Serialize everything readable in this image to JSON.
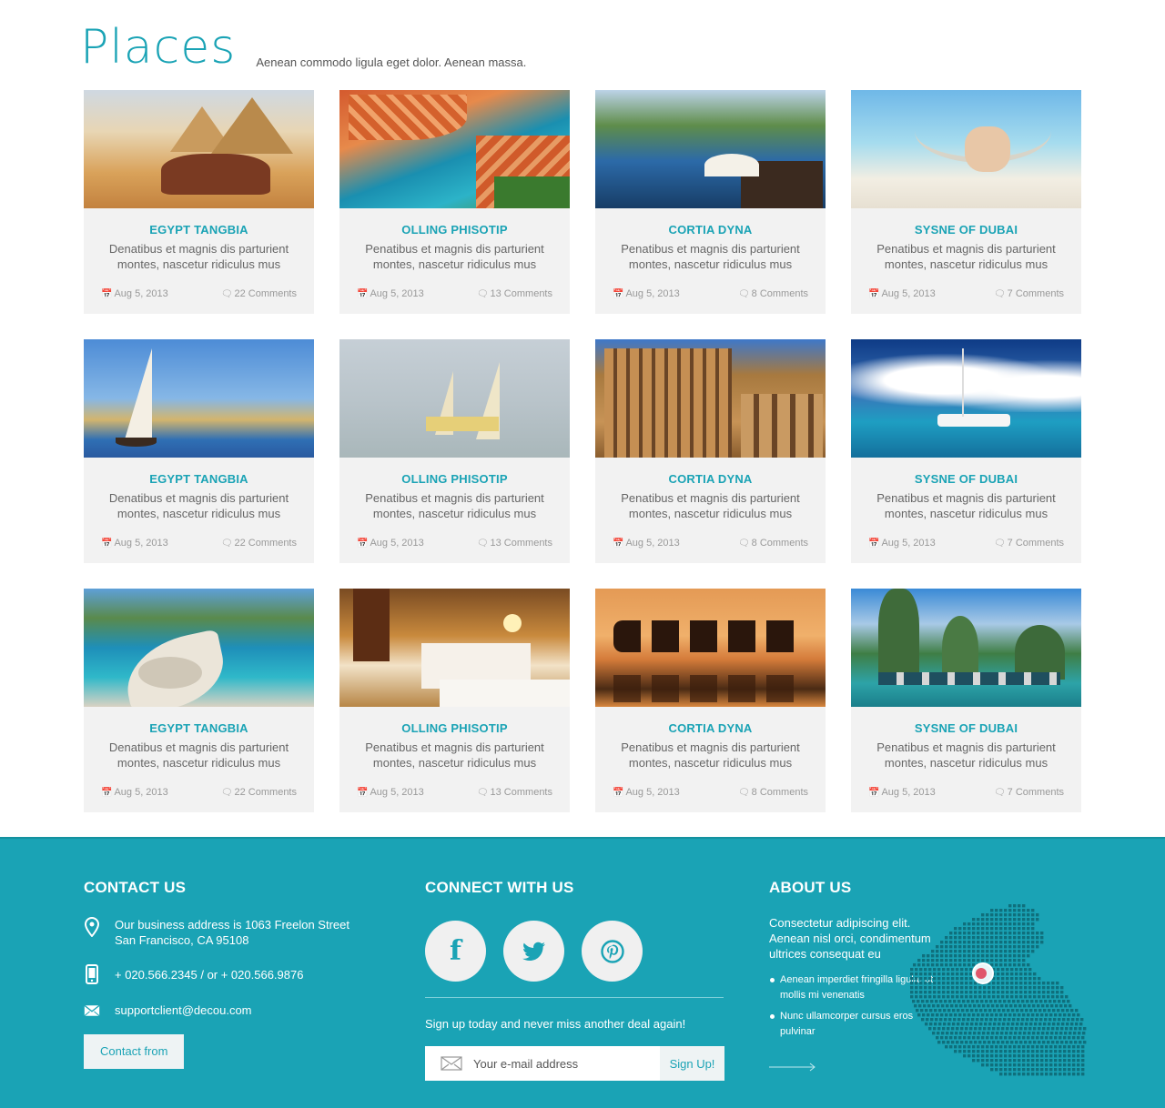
{
  "header": {
    "title": "Places",
    "subtitle": "Aenean commodo ligula eget dolor. Aenean massa."
  },
  "cards": [
    {
      "title": "EGYPT TANGBIA",
      "desc": "Denatibus et magnis dis parturient montes, nascetur ridiculus mus",
      "date": "Aug 5, 2013",
      "comments": "22 Comments",
      "image": "camels-pyramids"
    },
    {
      "title": "OLLING PHISOTIP",
      "desc": "Penatibus et magnis dis parturient montes, nascetur ridiculus mus",
      "date": "Aug 5, 2013",
      "comments": "13 Comments",
      "image": "coastal-town"
    },
    {
      "title": "CORTIA DYNA",
      "desc": "Penatibus et magnis dis parturient montes, nascetur ridiculus mus",
      "date": "Aug 5, 2013",
      "comments": "8 Comments",
      "image": "infinity-pool"
    },
    {
      "title": "SYSNE OF DUBAI",
      "desc": "Penatibus et magnis dis parturient montes, nascetur ridiculus mus",
      "date": "Aug 5, 2013",
      "comments": "7 Comments",
      "image": "beach-hammock"
    },
    {
      "title": "EGYPT TANGBIA",
      "desc": "Denatibus et magnis dis parturient montes, nascetur ridiculus mus",
      "date": "Aug 5, 2013",
      "comments": "22 Comments",
      "image": "sailboat-desert"
    },
    {
      "title": "OLLING PHISOTIP",
      "desc": "Penatibus et magnis dis parturient montes, nascetur ridiculus mus",
      "date": "Aug 5, 2013",
      "comments": "13 Comments",
      "image": "sailboats-haze"
    },
    {
      "title": "CORTIA DYNA",
      "desc": "Penatibus et magnis dis parturient montes, nascetur ridiculus mus",
      "date": "Aug 5, 2013",
      "comments": "8 Comments",
      "image": "ancient-ruins"
    },
    {
      "title": "SYSNE OF DUBAI",
      "desc": "Penatibus et magnis dis parturient montes, nascetur ridiculus mus",
      "date": "Aug 5, 2013",
      "comments": "7 Comments",
      "image": "catamaran"
    },
    {
      "title": "EGYPT TANGBIA",
      "desc": "Denatibus et magnis dis parturient montes, nascetur ridiculus mus",
      "date": "Aug 5, 2013",
      "comments": "22 Comments",
      "image": "rocky-coast"
    },
    {
      "title": "OLLING PHISOTIP",
      "desc": "Penatibus et magnis dis parturient montes, nascetur ridiculus mus",
      "date": "Aug 5, 2013",
      "comments": "13 Comments",
      "image": "hotel-room"
    },
    {
      "title": "CORTIA DYNA",
      "desc": "Penatibus et magnis dis parturient montes, nascetur ridiculus mus",
      "date": "Aug 5, 2013",
      "comments": "8 Comments",
      "image": "camel-caravan"
    },
    {
      "title": "SYSNE OF DUBAI",
      "desc": "Penatibus et magnis dis parturient montes, nascetur ridiculus mus",
      "date": "Aug 5, 2013",
      "comments": "7 Comments",
      "image": "karst-bay"
    }
  ],
  "footer": {
    "contact": {
      "heading": "CONTACT US",
      "address": "Our business address is 1063 Freelon Street San Francisco, CA 95108",
      "phone": "+ 020.566.2345 / or + 020.566.9876",
      "email": "supportclient@decou.com",
      "button": "Contact from"
    },
    "connect": {
      "heading": "CONNECT WITH US",
      "social": [
        {
          "label": "f",
          "icon": "facebook-icon"
        },
        {
          "label": "twitter",
          "icon": "twitter-icon"
        },
        {
          "label": "pinterest",
          "icon": "pinterest-icon"
        }
      ],
      "signup_text": "Sign up today and never miss another deal again!",
      "email_placeholder": "Your e-mail address",
      "signup_button": "Sign Up!"
    },
    "about": {
      "heading": "ABOUT US",
      "text": "Consectetur adipiscing elit. Aenean nisl orci, condimentum ultrices consequat eu",
      "bullets": [
        "Aenean imperdiet fringilla ligula, ut mollis mi venenatis",
        "Nunc ullamcorper cursus eros pulvinar"
      ]
    }
  },
  "colors": {
    "accent": "#1aa3b5",
    "card_bg": "#f2f2f2",
    "footer_bg": "#1aa3b5"
  }
}
